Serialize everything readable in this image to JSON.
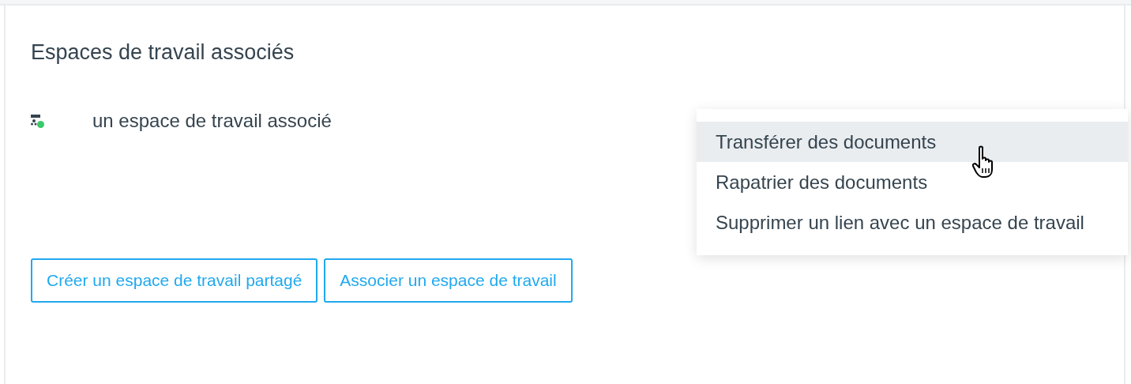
{
  "section": {
    "title": "Espaces de travail associés"
  },
  "workspaces": [
    {
      "name": "un espace de travail associé",
      "color": "#3cc86a"
    }
  ],
  "menu": {
    "items": [
      {
        "label": "Transférer des documents",
        "selected": true
      },
      {
        "label": "Rapatrier des documents",
        "selected": false
      },
      {
        "label": "Supprimer un lien avec un espace de travail",
        "selected": false
      }
    ]
  },
  "buttons": [
    "Créer un espace de travail partagé",
    "Associer un espace de travail"
  ]
}
